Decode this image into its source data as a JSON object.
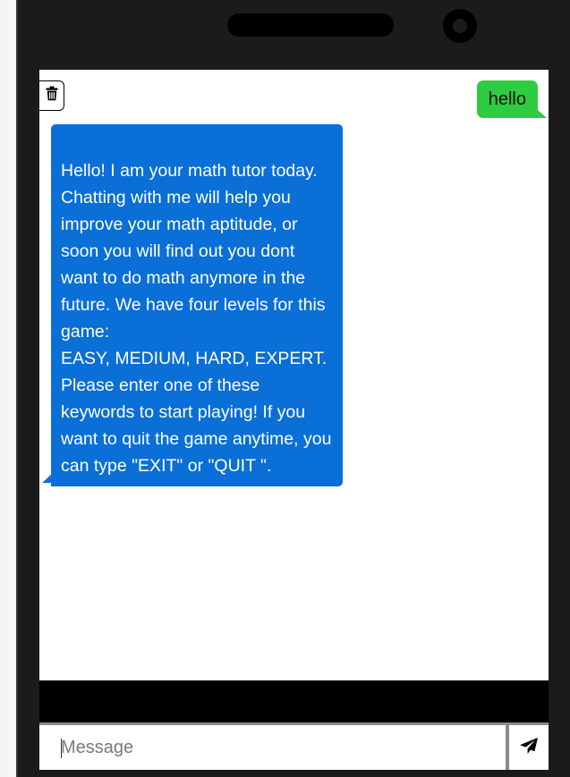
{
  "chat": {
    "messages": [
      {
        "sender": "user",
        "text": "hello"
      },
      {
        "sender": "bot",
        "text": "Hello! I am your math tutor today. Chatting with me will help you improve your math aptitude, or soon you will find out you dont want to do math anymore in the future. We have four levels for this game:\nEASY, MEDIUM, HARD, EXPERT.\nPlease enter one of these keywords to start playing! If you want to quit the game anytime, you can type \"EXIT\" or \"QUIT \"."
      }
    ]
  },
  "composer": {
    "placeholder": "Message",
    "value": ""
  },
  "icons": {
    "clear": "trash-icon",
    "send": "send-icon"
  },
  "colors": {
    "user_bubble": "#2ecc40",
    "bot_bubble": "#0a6fd6",
    "phone_frame": "#1b1b1b"
  }
}
